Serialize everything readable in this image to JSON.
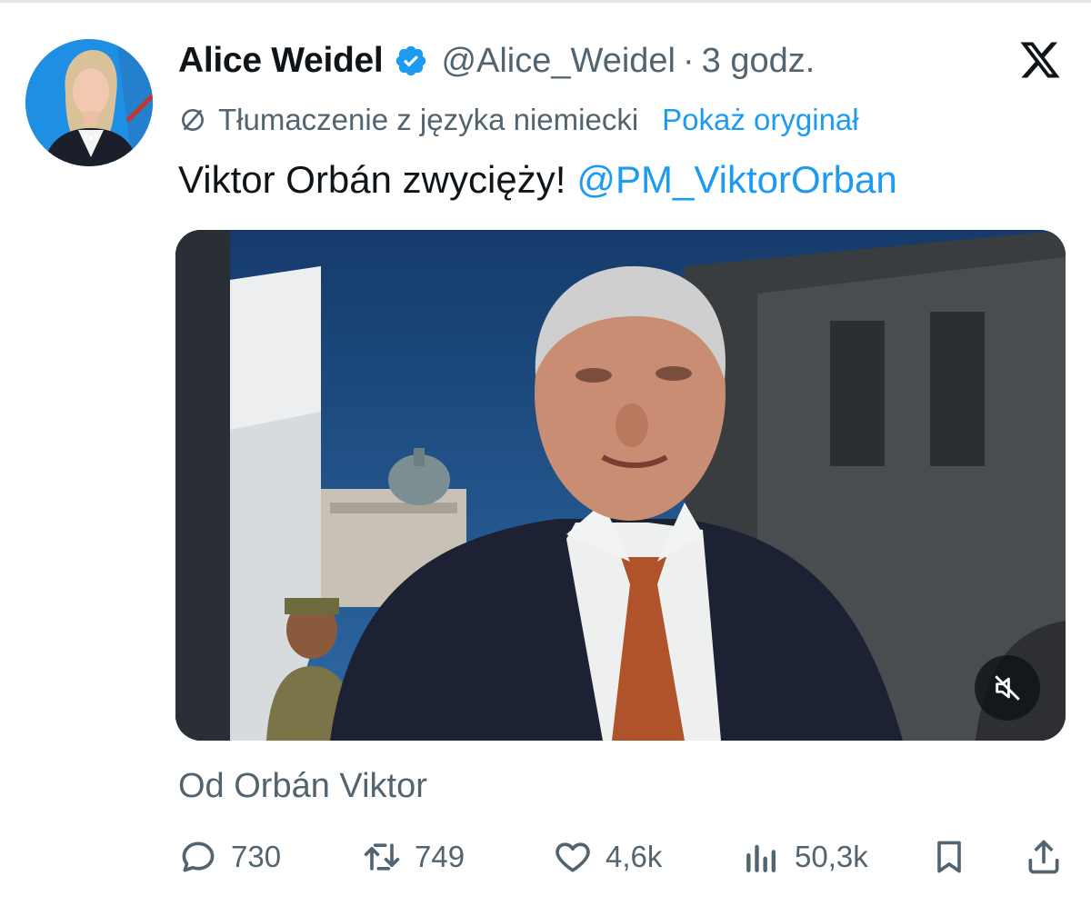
{
  "author": {
    "name": "Alice Weidel",
    "handle": "@Alice_Weidel",
    "separator": "·",
    "time": "3 godz.",
    "verified": true
  },
  "translation": {
    "note": "Tłumaczenie z języka niemiecki",
    "show_original": "Pokaż oryginał"
  },
  "tweet": {
    "text": "Viktor Orbán zwycięży!",
    "mention": "@PM_ViktorOrban"
  },
  "media": {
    "type": "video",
    "muted": true,
    "attribution": "Od Orbán Viktor"
  },
  "metrics": {
    "replies": "730",
    "reposts": "749",
    "likes": "4,6k",
    "views": "50,3k"
  },
  "icons": {
    "verified": "verified-badge-icon",
    "platform": "x-logo-icon",
    "translate": "translate-icon",
    "mute": "mute-icon",
    "reply": "reply-icon",
    "repost": "repost-icon",
    "like": "like-icon",
    "views": "views-icon",
    "bookmark": "bookmark-icon",
    "share": "share-icon"
  },
  "colors": {
    "accent": "#1d9bf0",
    "text_primary": "#0f1419",
    "text_secondary": "#536471",
    "background": "#ffffff"
  }
}
